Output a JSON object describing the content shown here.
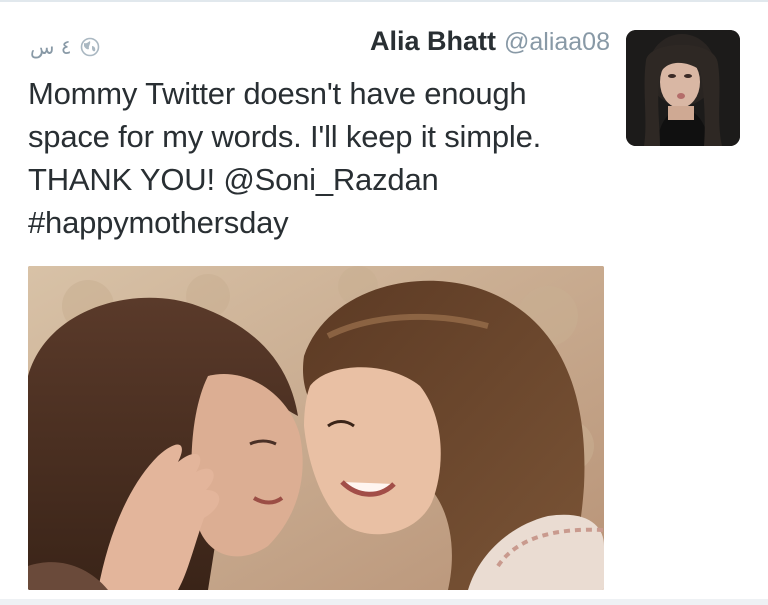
{
  "tweet": {
    "timestamp": "٤ س",
    "display_name": "Alia Bhatt",
    "handle": "@aliaa08",
    "text": "Mommy Twitter doesn't have enough\nspace for my words. I'll keep it simple.\nTHANK YOU! @Soni_Razdan\n#happymothersday",
    "privacy_icon": "globe-icon",
    "avatar_alt": "avatar",
    "media_alt": "photo"
  },
  "colors": {
    "text": "#292f33",
    "secondary": "#8899a6",
    "border": "#e1e8ed"
  }
}
